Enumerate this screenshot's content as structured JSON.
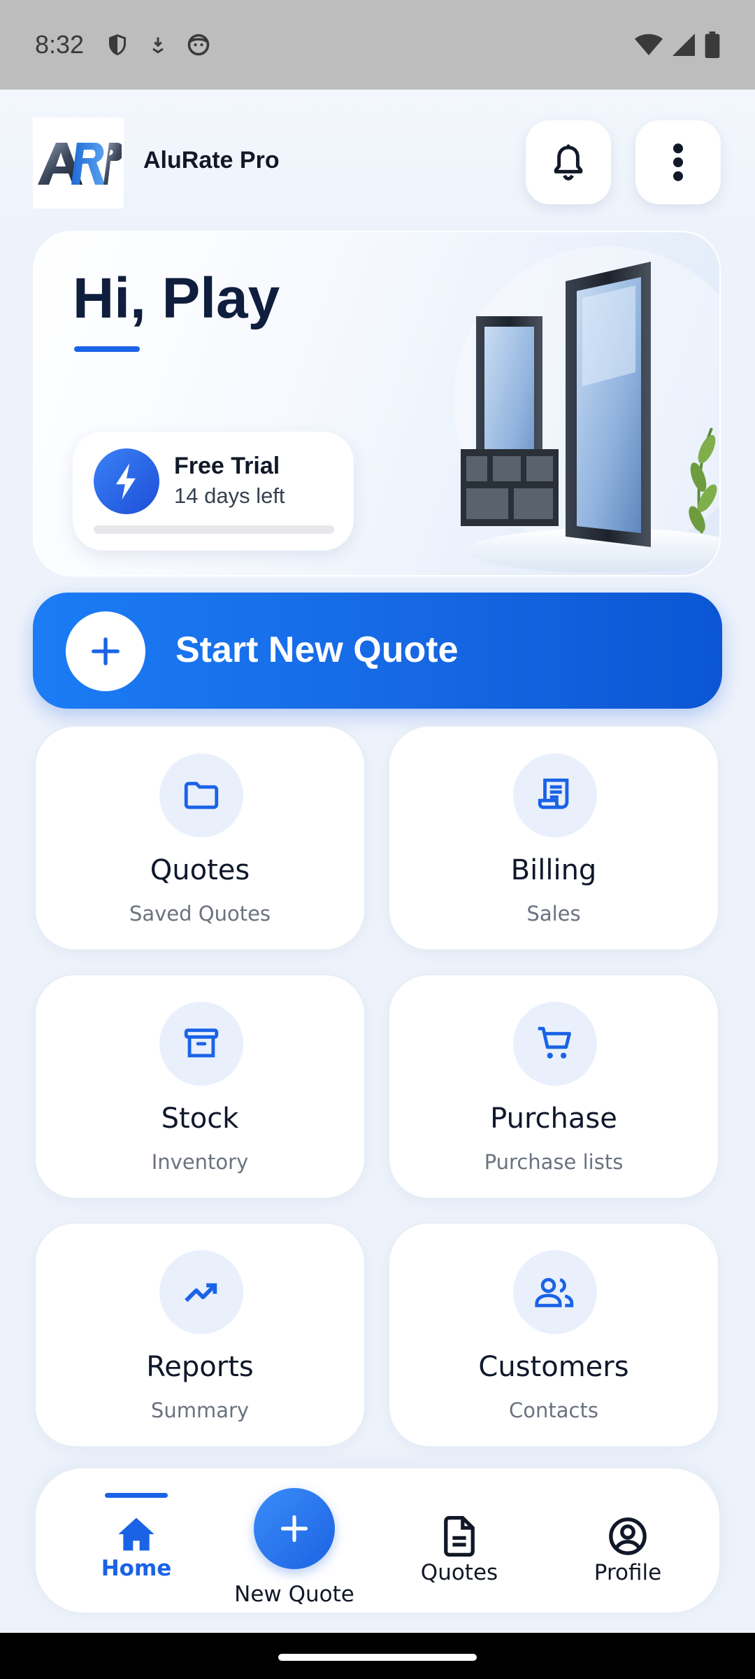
{
  "status_bar": {
    "time": "8:32"
  },
  "header": {
    "app_name": "AluRate Pro",
    "logo_text": "ARP"
  },
  "hero": {
    "greeting": "Hi, Play",
    "trial": {
      "title": "Free Trial",
      "subtitle": "14 days left",
      "progress": 0.0
    }
  },
  "cta": {
    "label": "Start New Quote"
  },
  "tiles": [
    {
      "title": "Quotes",
      "subtitle": "Saved Quotes",
      "icon": "folder-icon"
    },
    {
      "title": "Billing",
      "subtitle": "Sales",
      "icon": "receipt-icon"
    },
    {
      "title": "Stock",
      "subtitle": "Inventory",
      "icon": "archive-icon"
    },
    {
      "title": "Purchase",
      "subtitle": "Purchase lists",
      "icon": "cart-icon"
    },
    {
      "title": "Reports",
      "subtitle": "Summary",
      "icon": "trending-up-icon"
    },
    {
      "title": "Customers",
      "subtitle": "Contacts",
      "icon": "people-icon"
    }
  ],
  "nav": {
    "items": [
      {
        "label": "Home",
        "icon": "home-icon",
        "active": true
      },
      {
        "label": "New Quote",
        "icon": "plus-icon"
      },
      {
        "label": "Quotes",
        "icon": "document-icon"
      },
      {
        "label": "Profile",
        "icon": "account-circle-icon"
      }
    ]
  },
  "colors": {
    "accent": "#1a63e6",
    "tile_icon_bg": "#e9f0fc",
    "background": "#eef3fb"
  }
}
